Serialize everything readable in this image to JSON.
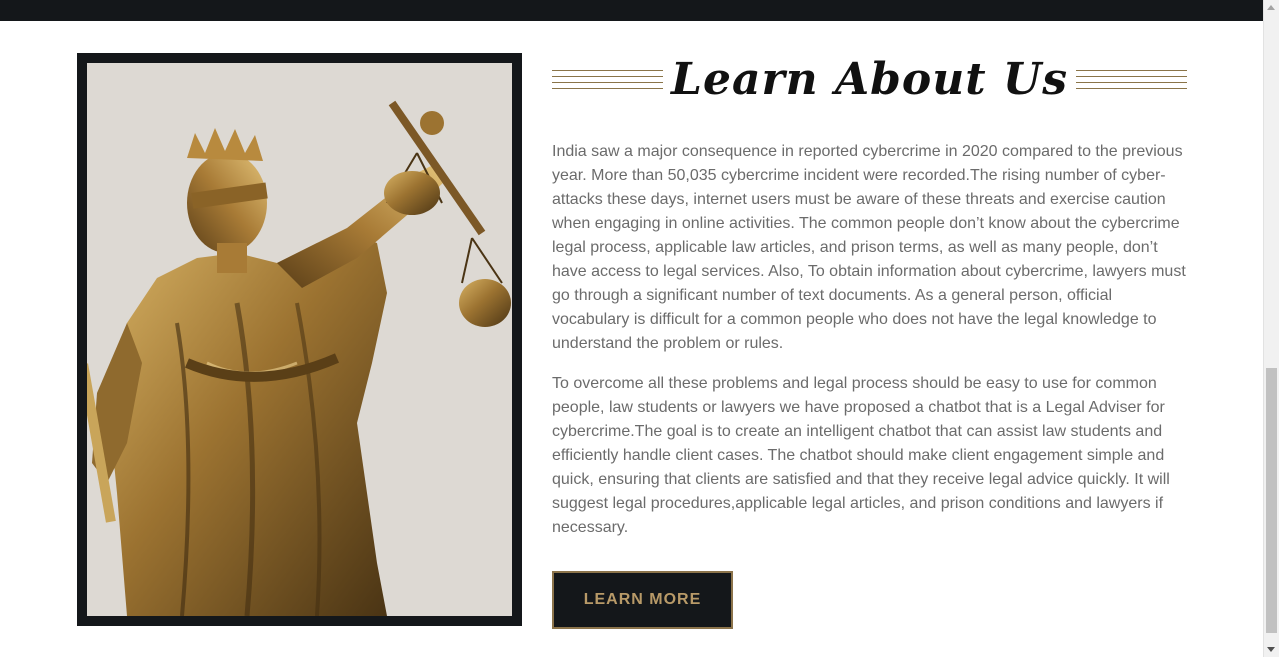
{
  "about": {
    "heading": "Learn About Us",
    "paragraph_1": "India saw a major consequence in reported cybercrime in 2020 compared to the previous year. More than 50,035 cybercrime incident were recorded.The rising number of cyber-attacks these days, internet users must be aware of these threats and exercise caution when engaging in online activities. The common people don’t know about the cybercrime legal process, applicable law articles, and prison terms, as well as many people, don’t have access to legal services. Also, To obtain information about cybercrime, lawyers must go through a significant number of text documents. As a general person, official vocabulary is difficult for a common people who does not have the legal knowledge to understand the problem or rules.",
    "paragraph_2": "To overcome all these problems and legal process should be easy to use for common people, law students or lawyers we have proposed a chatbot that is a Legal Adviser for cybercrime.The goal is to create an intelligent chatbot that can assist law students and efficiently handle client cases. The chatbot should make client engagement simple and quick, ensuring that clients are satisfied and that they receive legal advice quickly. It will suggest legal procedures,applicable legal articles, and prison conditions and lawyers if necessary.",
    "button_label": "LEARN MORE"
  },
  "image": {
    "subject": "lady-justice-statue"
  },
  "colors": {
    "dark": "#14171a",
    "gold": "#b89a68",
    "gold_border": "#8c744b",
    "body_text": "#6b6b6b"
  }
}
